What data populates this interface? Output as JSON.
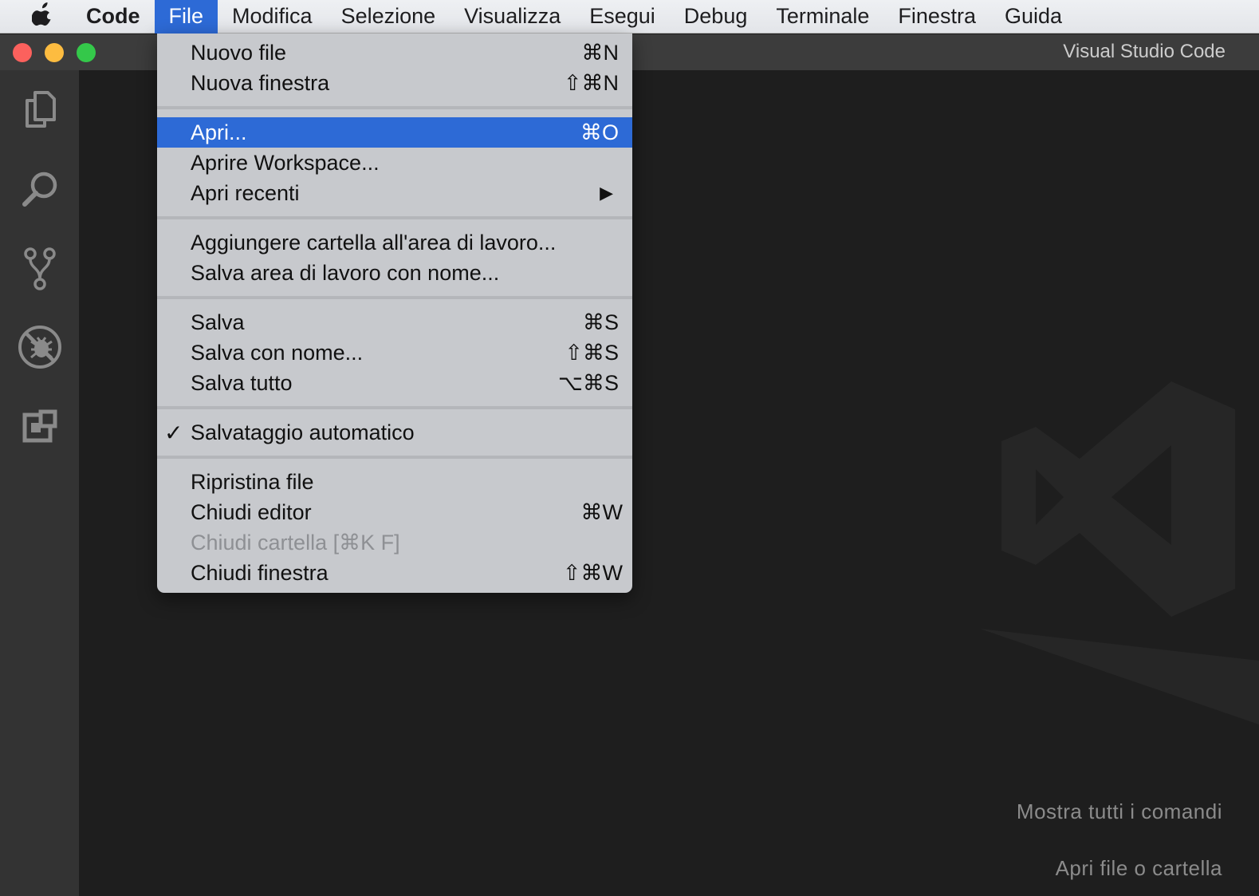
{
  "menubar": {
    "apple_icon": "apple-logo-icon",
    "items": [
      {
        "label": "Code"
      },
      {
        "label": "File"
      },
      {
        "label": "Modifica"
      },
      {
        "label": "Selezione"
      },
      {
        "label": "Visualizza"
      },
      {
        "label": "Esegui"
      },
      {
        "label": "Debug"
      },
      {
        "label": "Terminale"
      },
      {
        "label": "Finestra"
      },
      {
        "label": "Guida"
      }
    ]
  },
  "window": {
    "title": "Visual Studio Code"
  },
  "activitybar": {
    "icons": [
      "explorer-icon",
      "search-icon",
      "source-control-icon",
      "debug-icon",
      "extensions-icon"
    ]
  },
  "file_menu": {
    "items": [
      {
        "label": "Nuovo file",
        "shortcut": "⌘N"
      },
      {
        "label": "Nuova finestra",
        "shortcut": "⇧⌘N"
      },
      {
        "label": "Apri...",
        "shortcut": "⌘O",
        "highlighted": true
      },
      {
        "label": "Aprire Workspace..."
      },
      {
        "label": "Apri recenti",
        "submenu_arrow": "▶"
      },
      {
        "label": "Aggiungere cartella all'area di lavoro..."
      },
      {
        "label": "Salva area di lavoro con nome..."
      },
      {
        "label": "Salva",
        "shortcut": "⌘S"
      },
      {
        "label": "Salva con nome...",
        "shortcut": "⇧⌘S"
      },
      {
        "label": "Salva tutto",
        "shortcut": "⌥⌘S"
      },
      {
        "label": "Salvataggio automatico",
        "checkmark": "✓",
        "checked": true
      },
      {
        "label": "Ripristina file"
      },
      {
        "label": "Chiudi editor",
        "shortcut": "⌘W"
      },
      {
        "label": "Chiudi cartella [⌘K F]",
        "disabled": true
      },
      {
        "label": "Chiudi finestra",
        "shortcut": "⇧⌘W"
      }
    ]
  },
  "editor": {
    "watermark_icon": "vscode-logo-icon",
    "hints": [
      "Mostra tutti i comandi",
      "Apri file o cartella"
    ]
  },
  "colors": {
    "menu_highlight": "#2d6ad6",
    "editor_background": "#1e1e1e",
    "activitybar_background": "#333333",
    "titlebar_background": "#3c3c3c"
  }
}
